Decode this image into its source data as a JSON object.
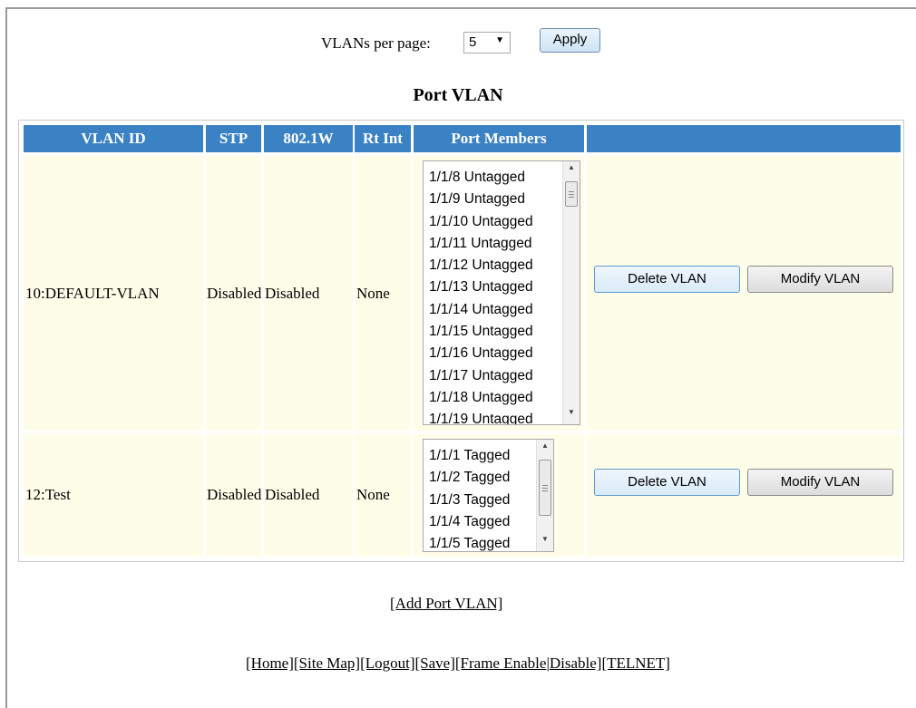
{
  "per_page": {
    "label": "VLANs per page:",
    "value": "5",
    "apply_label": "Apply"
  },
  "title": "Port VLAN",
  "table": {
    "headers": [
      "VLAN ID",
      "STP",
      "802.1W",
      "Rt Int",
      "Port Members",
      ""
    ],
    "rows": [
      {
        "vlan_id": "10:DEFAULT-VLAN",
        "stp": "Disabled",
        "w8021": "Disabled",
        "rt_int": "None",
        "members": [
          "1/1/8 Untagged",
          "1/1/9 Untagged",
          "1/1/10 Untagged",
          "1/1/11 Untagged",
          "1/1/12 Untagged",
          "1/1/13 Untagged",
          "1/1/14 Untagged",
          "1/1/15 Untagged",
          "1/1/16 Untagged",
          "1/1/17 Untagged",
          "1/1/18 Untagged",
          "1/1/19 Untagged"
        ],
        "delete_label": "Delete VLAN",
        "modify_label": "Modify VLAN"
      },
      {
        "vlan_id": "12:Test",
        "stp": "Disabled",
        "w8021": "Disabled",
        "rt_int": "None",
        "members": [
          "1/1/1 Tagged",
          "1/1/2 Tagged",
          "1/1/3 Tagged",
          "1/1/4 Tagged",
          "1/1/5 Tagged"
        ],
        "delete_label": "Delete VLAN",
        "modify_label": "Modify VLAN"
      }
    ]
  },
  "add_link": "[Add Port VLAN]",
  "footer": {
    "links": [
      "[Home]",
      "[Site Map]",
      "[Logout]",
      "[Save]",
      "[Frame Enable",
      "|",
      "Disable]",
      "[TELNET]"
    ]
  }
}
